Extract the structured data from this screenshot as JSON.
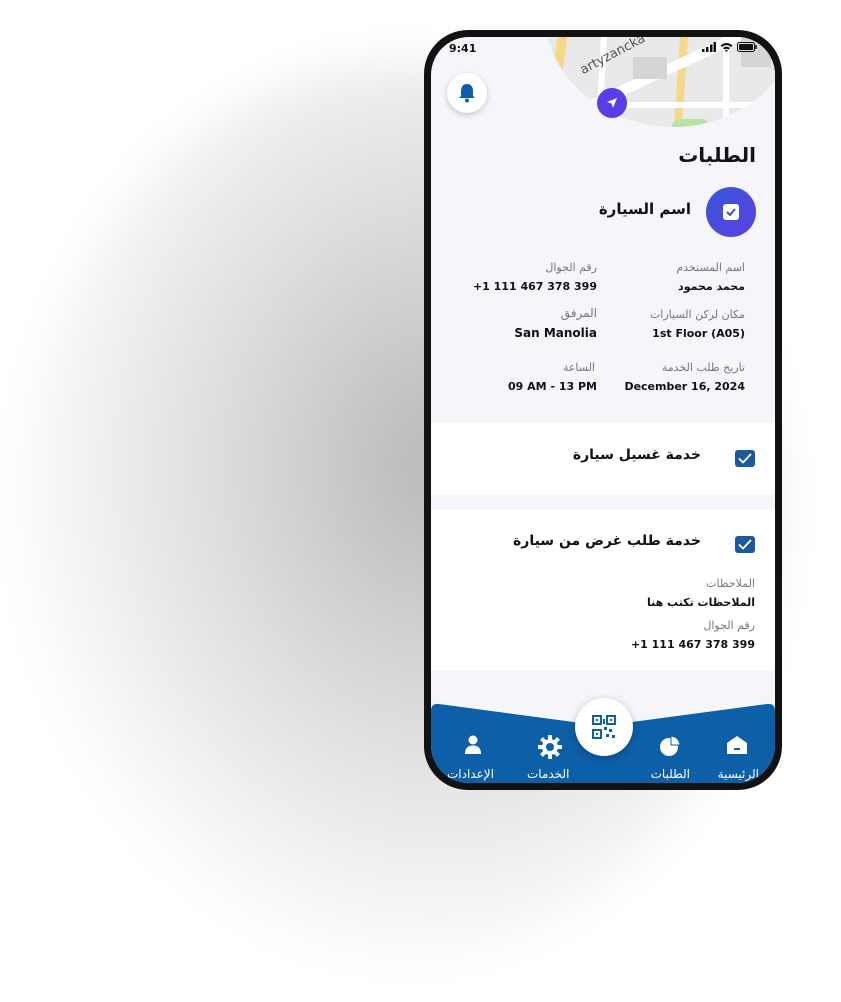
{
  "status_bar": {
    "time": "9:41"
  },
  "map": {
    "street_label": "artyzancka"
  },
  "page_title": "الطلبات",
  "car": {
    "name": "اسم السيارة"
  },
  "details": {
    "username_label": "اسم المستخدم",
    "username_value": "محمد محمود",
    "phone_label": "رقم الجوال",
    "phone_value": "+1 111 467 378 399",
    "parking_label": "مكان لركن السيارات",
    "parking_value": "1st Floor (A05)",
    "facility_label": "المرفق",
    "facility_value": "San Manolia",
    "date_label": "تاريخ طلب الخدمة",
    "date_value": "December 16, 2024",
    "time_label": "الساعة",
    "time_value": "09 AM - 13 PM"
  },
  "services": [
    {
      "title": "خدمة غسيل سيارة",
      "checked": true
    },
    {
      "title": "خدمة طلب غرض من سيارة",
      "checked": true,
      "notes_label": "الملاحظات",
      "notes_value": "الملاحظات تكتب هنا",
      "phone_label": "رقم الجوال",
      "phone_value": "+1 111 467 378 399"
    }
  ],
  "bottom_nav": {
    "home": "الرئيسية",
    "orders": "الطلبات",
    "services": "الخدمات",
    "settings": "الإعدادات"
  },
  "colors": {
    "primary_blue": "#0d5fa8",
    "accent_purple": "#5b3de8",
    "checkbox_blue": "#1c5aa0",
    "background": "#f6f6fa"
  },
  "icons": [
    "bell-icon",
    "navigation-arrow-icon",
    "checkbox-icon",
    "home-icon",
    "orders-pie-icon",
    "qr-code-icon",
    "gear-icon",
    "user-icon",
    "signal-icon",
    "wifi-icon",
    "battery-icon"
  ]
}
